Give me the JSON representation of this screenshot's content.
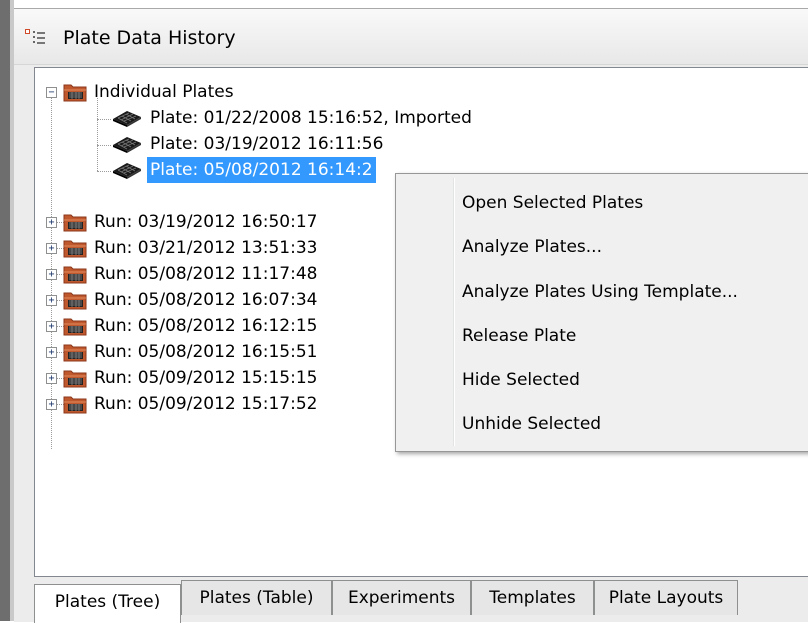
{
  "window": {
    "title": "Plate Data History"
  },
  "tree": {
    "root": {
      "label": "Individual Plates"
    },
    "plates": [
      {
        "label": "Plate: 01/22/2008 15:16:52, Imported"
      },
      {
        "label": "Plate: 03/19/2012 16:11:56"
      },
      {
        "label": "Plate: 05/08/2012 16:14:2"
      }
    ],
    "runs": [
      {
        "label": "Run: 03/19/2012 16:50:17"
      },
      {
        "label": "Run: 03/21/2012 13:51:33"
      },
      {
        "label": "Run: 05/08/2012 11:17:48"
      },
      {
        "label": "Run: 05/08/2012 16:07:34"
      },
      {
        "label": "Run: 05/08/2012 16:12:15"
      },
      {
        "label": "Run: 05/08/2012 16:15:51"
      },
      {
        "label": "Run: 05/09/2012 15:15:15"
      },
      {
        "label": "Run: 05/09/2012 15:17:52"
      }
    ]
  },
  "context_menu": {
    "items": [
      {
        "label": "Open Selected Plates"
      },
      {
        "label": "Analyze Plates..."
      },
      {
        "label": "Analyze Plates Using Template..."
      },
      {
        "label": "Release Plate"
      },
      {
        "label": "Hide Selected"
      },
      {
        "label": "Unhide Selected"
      }
    ]
  },
  "tabs": [
    {
      "label": "Plates (Tree)",
      "active": true
    },
    {
      "label": "Plates (Table)"
    },
    {
      "label": "Experiments"
    },
    {
      "label": "Templates"
    },
    {
      "label": "Plate Layouts"
    }
  ],
  "colors": {
    "selection": "#3399ff",
    "folder": "#c0582e"
  }
}
